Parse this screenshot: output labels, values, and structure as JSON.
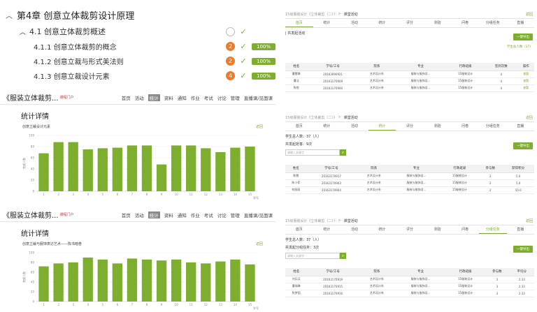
{
  "outline": {
    "chapter": "第4章 创意立体裁剪设计原理",
    "section": {
      "label": "4.1 创意立体裁剪概述"
    },
    "subsections": [
      {
        "label": "4.1.1 创意立体裁剪的概念",
        "badge": "2",
        "pct": "100%"
      },
      {
        "label": "4.1.2 创意立裁与形式美法则",
        "badge": "2",
        "pct": "100%"
      },
      {
        "label": "4.1.3 创意立裁设计元素",
        "badge": "4",
        "pct": "100%"
      }
    ]
  },
  "course_nav": [
    "首页",
    "活动",
    "统计",
    "资料",
    "通知",
    "作业",
    "考试",
    "讨论",
    "管理",
    "直播课/见面课"
  ],
  "course1": {
    "title": "《服装立体裁剪...",
    "link": "课程门户",
    "active": "统计",
    "stat_heading": "统计详情",
    "chart_title": "创意立裁设计元素",
    "back": "返回"
  },
  "course2": {
    "title": "《服装立体裁剪...",
    "link": "课程门户",
    "active": "统计",
    "stat_heading": "统计详情",
    "chart_title": "创意立裁与服饰表达艺术——陈书暗卷",
    "back": "返回"
  },
  "chart_data": [
    {
      "type": "bar",
      "categories": [
        "1",
        "2",
        "3",
        "4",
        "5",
        "6",
        "7",
        "8",
        "9",
        "10",
        "11",
        "12",
        "13",
        "14",
        "15"
      ],
      "values": [
        68,
        88,
        88,
        75,
        77,
        78,
        82,
        82,
        48,
        82,
        82,
        77,
        70,
        78,
        80
      ],
      "ylim": [
        0,
        100
      ],
      "yticks": [
        "0",
        "20",
        "40",
        "60",
        "80",
        "100"
      ],
      "ylabel": "完成人数",
      "xlabel": "学号",
      "color": "#7dae2e"
    },
    {
      "type": "bar",
      "categories": [
        "1",
        "2",
        "3",
        "4",
        "5",
        "6",
        "7",
        "8",
        "9",
        "10",
        "11",
        "12",
        "13",
        "14",
        "15"
      ],
      "values": [
        72,
        78,
        80,
        90,
        86,
        78,
        88,
        86,
        84,
        86,
        80,
        78,
        82,
        86,
        76
      ],
      "ylim": [
        0,
        100
      ],
      "yticks": [
        "0",
        "20",
        "40",
        "60",
        "80",
        "100"
      ],
      "ylabel": "完成人数",
      "xlabel": "学号",
      "color": "#7dae2e"
    }
  ],
  "tabs": [
    "首页",
    "统计",
    "活动",
    "统计",
    "评分",
    "测验",
    "问卷",
    "分组任务",
    "直播"
  ],
  "right1": {
    "breadcrumb": "15级服装设计《立体裁剪（二）》",
    "crumb_cur": "课堂活动",
    "back": "返回",
    "active_tab": 0,
    "info": "| 共发起活动",
    "btn": "一键导出",
    "count": "学生总人数（37）",
    "headers": [
      "姓名",
      "学号/工号",
      "院系",
      "专业",
      "行政班级",
      "签到次数",
      "操作"
    ],
    "rows": [
      [
        "曹慧琳",
        "20163090921",
        "艺术设计系",
        "服装与服饰设...",
        "15服装设计",
        "4",
        "查看"
      ],
      [
        "曹洁",
        "20163170909",
        "艺术设计系",
        "服装与服饰设...",
        "15服装设计",
        "4",
        "查看"
      ],
      [
        "陈悦",
        "20163170900",
        "艺术设计系",
        "服装与服饰设...",
        "15服装设计",
        "4",
        "查看"
      ]
    ]
  },
  "right2": {
    "breadcrumb": "15级服装设计《立体裁剪（二）》",
    "crumb_cur": "课堂活动",
    "back": "返回",
    "active_tab": 3,
    "info": "学生总人数：37（人）",
    "sub": "共发起抢答：9次",
    "btn": "一键导出",
    "placeholder": "请输入关键字",
    "headers": [
      "姓名",
      "学号/工号",
      "院系",
      "专业",
      "行政班级",
      "参与数",
      "获得积分"
    ],
    "rows": [
      [
        "陈慧",
        "20163170917",
        "艺术设计系",
        "服装与服饰设...",
        "15服装设计",
        "2",
        "5.0"
      ],
      [
        "陈小菲",
        "20163170903",
        "艺术设计系",
        "服装与服饰设...",
        "15服装设计",
        "2",
        "5.0"
      ],
      [
        "何丽丽",
        "20163170904",
        "艺术设计系",
        "服装与服饰设...",
        "15服装设计",
        "2",
        "10.0"
      ]
    ]
  },
  "right3": {
    "breadcrumb": "15级服装设计《立体裁剪（二）》",
    "crumb_cur": "课堂活动",
    "back": "返回",
    "active_tab": 7,
    "info": "学生总人数：37（人）",
    "sub": "共发起分组任务：3次",
    "btn": "一键导出",
    "placeholder": "请输入关键字",
    "headers": [
      "姓名",
      "学号/工号",
      "院系",
      "专业",
      "行政班级",
      "参与数",
      "平均分"
    ],
    "rows": [
      [
        "刘兵兵",
        "20163170919",
        "艺术设计系",
        "服装与服饰设...",
        "15服装设计",
        "3",
        "2.33"
      ],
      [
        "曹瑞琳",
        "20163170915",
        "艺术设计系",
        "服装与服饰设...",
        "15服装设计",
        "3",
        "2.33"
      ],
      [
        "陈梦丽",
        "20163170916",
        "艺术设计系",
        "服装与服饰设...",
        "15服装设计",
        "3",
        "2.33"
      ]
    ]
  }
}
